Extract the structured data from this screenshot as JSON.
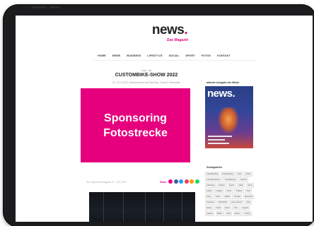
{
  "site": {
    "logo_word": "news",
    "logo_dot": ".",
    "tagline": "Das Magazin"
  },
  "nav": {
    "items": [
      "HOME",
      "NEWS",
      "BUSINESS",
      "LIFESTYLE",
      "SOCIAL",
      "SPORT",
      "FOTOS",
      "KONTAKT"
    ]
  },
  "article": {
    "category": "Link · 1A",
    "title": "CUSTOMBIKE-SHOW 2022",
    "meta": "20. 12.12.2022, Nimiceantsconcept Star Bau, Fotos & Unterseiten",
    "promo_line1": "Sponsoring",
    "promo_line2": "Fotostrecke",
    "share_meta": "Teil, Spannend Magazin 21 · 122.2022",
    "share_label": "Share"
  },
  "share_colors": [
    "#e6007e",
    "#3b5998",
    "#1da1f2",
    "#e4405f",
    "#ff9900",
    "#25d366"
  ],
  "sidebar": {
    "cover_label": "aktuelle Ausgabe als eBook",
    "cover_logo": "news.",
    "tags_head": "Schlagwörter",
    "tags": [
      "crowdfunding",
      "crowdfunding",
      "cash",
      "Clubs",
      "Fahrradmuseum",
      "Ausstellungen",
      "Heimat",
      "Nürnberg",
      "Wissen",
      "Nacht",
      "Kultur",
      "Sport",
      "Musik",
      "Lokales",
      "Kunst",
      "Theater",
      "Fest",
      "Party",
      "Fotos",
      "Hallen",
      "Konzert",
      "Motorrad",
      "Gewerbe",
      "Wirtschaft",
      "Unternehmen",
      "Film",
      "Reise",
      "Kunst",
      "Event",
      "Tour",
      "Jugend",
      "Galerie",
      "Bühne",
      "Fest",
      "Essen",
      "Trinken"
    ]
  }
}
